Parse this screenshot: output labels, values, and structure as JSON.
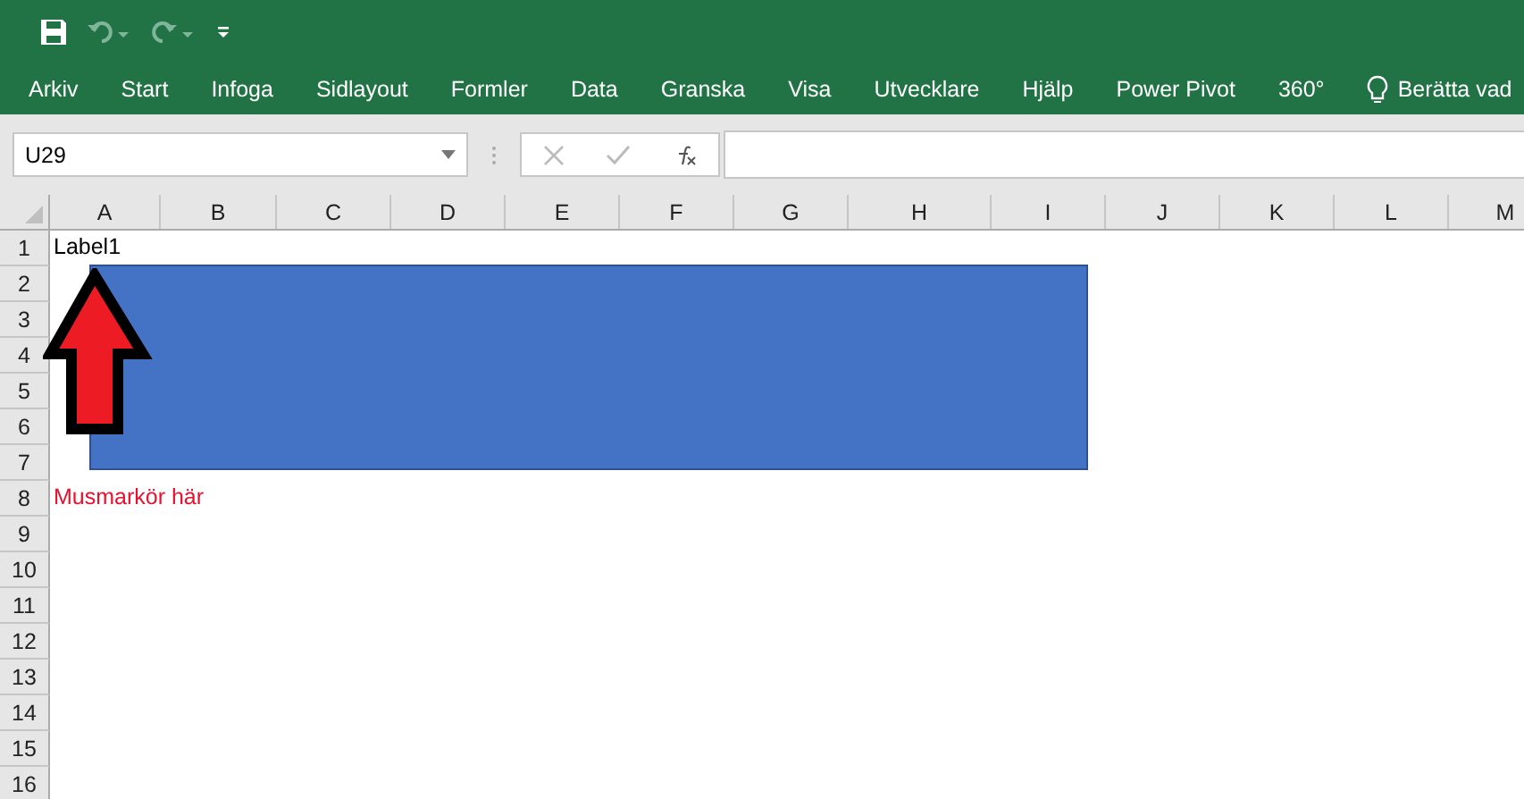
{
  "ribbon_tabs": [
    "Arkiv",
    "Start",
    "Infoga",
    "Sidlayout",
    "Formler",
    "Data",
    "Granska",
    "Visa",
    "Utvecklare",
    "Hjälp",
    "Power Pivot",
    "360°"
  ],
  "tell_me": "Berätta vad",
  "name_box": "U29",
  "sheet": {
    "columns": [
      "A",
      "B",
      "C",
      "D",
      "E",
      "F",
      "G",
      "H",
      "I",
      "J",
      "K",
      "L",
      "M"
    ],
    "rows": [
      {
        "label": "1",
        "cell_a": {
          "text": "Label1",
          "kind": "plain"
        }
      },
      {
        "label": "2"
      },
      {
        "label": "3"
      },
      {
        "label": "4"
      },
      {
        "label": "5"
      },
      {
        "label": "6"
      },
      {
        "label": "7"
      },
      {
        "label": "8",
        "cell_a": {
          "text": "Musmarkör här",
          "kind": "red"
        }
      },
      {
        "label": "9"
      },
      {
        "label": "10"
      },
      {
        "label": "11"
      },
      {
        "label": "12"
      },
      {
        "label": "13"
      },
      {
        "label": "14"
      },
      {
        "label": "15"
      },
      {
        "label": "16"
      }
    ],
    "shapes": [
      {
        "kind": "rectangle",
        "color": "#4472c4"
      },
      {
        "kind": "arrow",
        "color": "#ed1c24"
      }
    ]
  }
}
